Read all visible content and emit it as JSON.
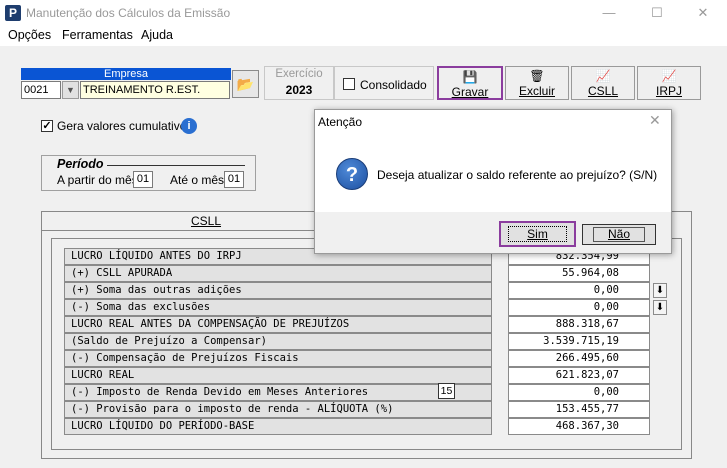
{
  "window": {
    "title": "Manutenção dos Cálculos da Emissão",
    "app_icon": "P",
    "minimize": "—",
    "maximize": "☐",
    "close": "✕"
  },
  "menu": [
    "Opções",
    "Ferramentas",
    "Ajuda"
  ],
  "empresa": {
    "header": "Empresa",
    "code": "0021",
    "name": "TREINAMENTO R.EST."
  },
  "exercicio": {
    "label": "Exercício",
    "value": "2023"
  },
  "consolidado": {
    "label": "Consolidado",
    "checked": false
  },
  "toolbar": {
    "gravar": "Gravar",
    "excluir": "Excluir",
    "csll": "CSLL",
    "irpj": "IRPJ"
  },
  "gera_valores": {
    "label": "Gera valores cumulativos",
    "checked": true
  },
  "periodo": {
    "title": "Período",
    "a_partir_label": "A partir do mês",
    "a_partir_value": "01",
    "ate_label": "Até o mês",
    "ate_value": "01"
  },
  "tab": "CSLL",
  "rows": [
    {
      "label": "LUCRO LÍQUIDO ANTES DO IRPJ",
      "value": "832.354,99"
    },
    {
      "label": "(+) CSLL APURADA",
      "value": "55.964,08"
    },
    {
      "label": "(+) Soma das outras adições",
      "value": "0,00"
    },
    {
      "label": "(-) Soma das exclusões",
      "value": "0,00"
    },
    {
      "label": "LUCRO REAL ANTES DA COMPENSAÇÃO DE PREJUÍZOS",
      "value": "888.318,67"
    },
    {
      "label": "(Saldo de Prejuízo a Compensar)",
      "value": "3.539.715,19"
    },
    {
      "label": "(-) Compensação de Prejuízos Fiscais",
      "value": "266.495,60"
    },
    {
      "label": "LUCRO REAL",
      "value": "621.823,07"
    },
    {
      "label": "(-) Imposto de Renda Devido em Meses Anteriores",
      "value": "0,00"
    },
    {
      "label": "(-) Provisão para o imposto de renda - ALÍQUOTA (%)",
      "value": "153.455,77"
    },
    {
      "label": "LUCRO LÍQUIDO DO PERÍODO-BASE",
      "value": "468.367,30"
    }
  ],
  "aliquota_month": "15",
  "dialog": {
    "title": "Atenção",
    "message": "Deseja atualizar o saldo referente ao prejuízo? (S/N)",
    "sim": "Sim",
    "nao": "Não",
    "close": "✕"
  },
  "colors": {
    "accent": "#0a55d4",
    "highlight": "#8b3d9e"
  }
}
